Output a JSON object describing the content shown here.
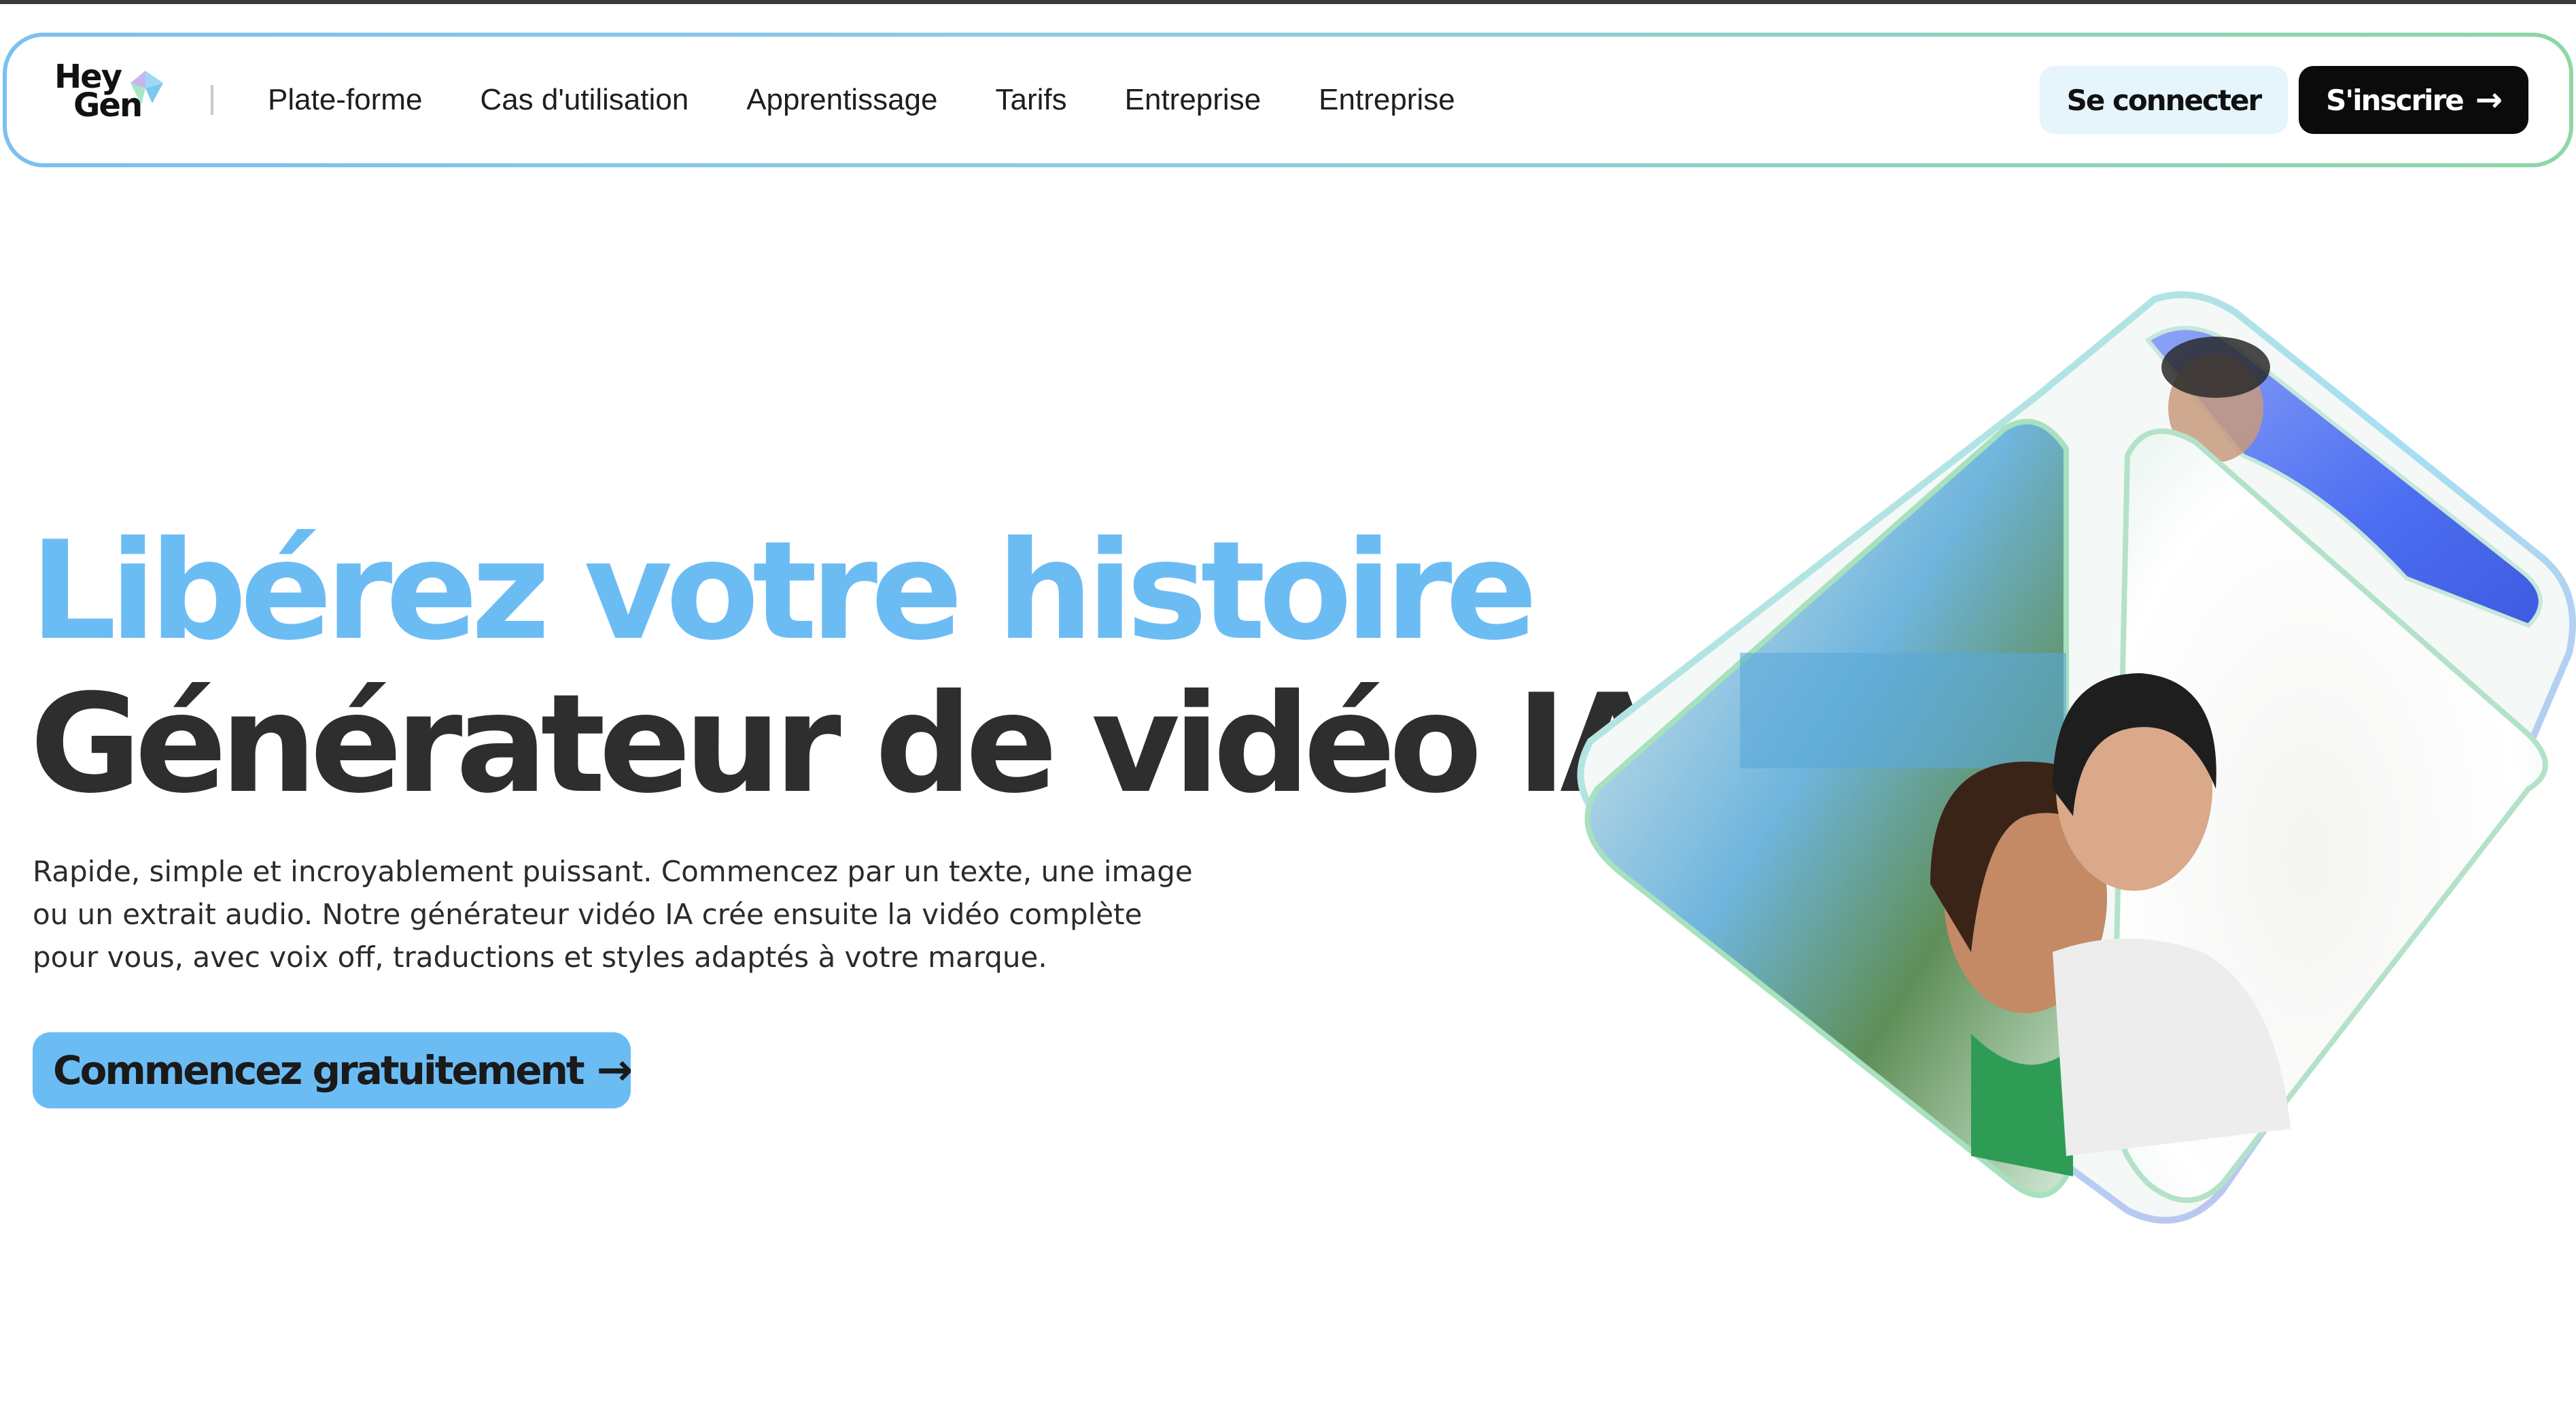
{
  "brand": {
    "logo_line1": "Hey",
    "logo_line2": "Gen",
    "colors": {
      "accent_blue": "#6cbcf4",
      "heading_dark": "#2e2e2e",
      "signup_bg": "#0b0b0b",
      "login_bg": "#e6f4fb",
      "nav_border_start": "#7cc0ef",
      "nav_border_end": "#8fd6a6"
    }
  },
  "nav": {
    "links": [
      {
        "label": "Plate-forme"
      },
      {
        "label": "Cas d'utilisation"
      },
      {
        "label": "Apprentissage"
      },
      {
        "label": "Tarifs"
      },
      {
        "label": "Entreprise"
      },
      {
        "label": "Entreprise"
      }
    ],
    "login_label": "Se connecter",
    "signup_label": "S'inscrire",
    "signup_icon": "arrow-right-icon"
  },
  "hero": {
    "title_line1": "Libérez votre histoire",
    "title_line2": "Générateur de vidéo IA",
    "description": "Rapide, simple et incroyablement puissant. Commencez par un texte, une image ou un extrait audio. Notre générateur vidéo IA crée ensuite la vidéo complète pour vous, avec voix off, traductions et styles adaptés à votre marque.",
    "cta_label": "Commencez gratuitement",
    "cta_icon": "arrow-right-icon"
  },
  "visual": {
    "description_icon": "3d-play-shape-with-avatar-video-faces"
  }
}
